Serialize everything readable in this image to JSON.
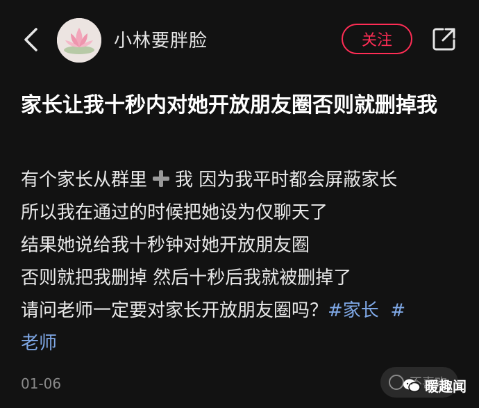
{
  "header": {
    "username": "小林要胖脸",
    "follow_label": "关注"
  },
  "post": {
    "title": "家长让我十秒内对她开放朋友圈否则就删掉我",
    "lines": [
      {
        "before": "有个家长从群里",
        "after": "我  因为我平时都会屏蔽家长"
      },
      {
        "text": "所以我在通过的时候把她设为仅聊天了"
      },
      {
        "text": "结果她说给我十秒钟对她开放朋友圈"
      },
      {
        "text": "否则就把我删掉 然后十秒后我就被删掉了"
      },
      {
        "text": "请问老师一定要对家长开放朋友圈吗？"
      }
    ],
    "tags": [
      "#家长",
      "#老师"
    ],
    "date": "01-06"
  },
  "footer": {
    "dislike_label": "不喜欢",
    "watermark": "暖趣闻"
  },
  "colors": {
    "background": "#121212",
    "accent": "#ff2d55",
    "tag": "#7fa8e6"
  },
  "icons": {
    "back": "chevron-left-icon",
    "share": "share-icon",
    "plus": "plus-icon",
    "dislike": "dislike-face-icon",
    "watermark": "wechat-icon"
  }
}
